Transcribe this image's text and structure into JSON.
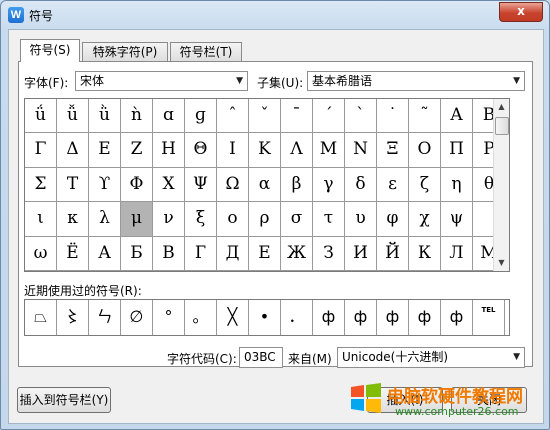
{
  "window": {
    "title": "符号",
    "close_label": "x",
    "app_icon": "W"
  },
  "tabs": [
    {
      "label": "符号(S)",
      "active": true
    },
    {
      "label": "特殊字符(P)",
      "active": false
    },
    {
      "label": "符号栏(T)",
      "active": false
    }
  ],
  "font": {
    "label": "字体(F):",
    "value": "宋体"
  },
  "subset": {
    "label": "子集(U):",
    "value": "基本希腊语"
  },
  "symbols": [
    [
      "ǘ",
      "ǚ",
      "ǜ",
      "ǹ",
      "ɑ",
      "ɡ",
      "ˆ",
      "ˇ",
      "ˉ",
      "ˊ",
      "ˋ",
      "˙",
      "˜",
      "Α",
      "Β"
    ],
    [
      "Γ",
      "Δ",
      "Ε",
      "Ζ",
      "Η",
      "Θ",
      "Ι",
      "Κ",
      "Λ",
      "Μ",
      "Ν",
      "Ξ",
      "Ο",
      "Π",
      "Ρ"
    ],
    [
      "Σ",
      "Τ",
      "ϒ",
      "Φ",
      "Χ",
      "Ψ",
      "Ω",
      "α",
      "β",
      "γ",
      "δ",
      "ε",
      "ζ",
      "η",
      "θ"
    ],
    [
      "ι",
      "κ",
      "λ",
      "μ",
      "ν",
      "ξ",
      "ο",
      "ρ",
      "σ",
      "τ",
      "υ",
      "φ",
      "χ",
      "ψ",
      ""
    ],
    [
      "ω",
      "Ё",
      "А",
      "Б",
      "В",
      "Г",
      "Д",
      "Е",
      "Ж",
      "З",
      "И",
      "Й",
      "К",
      "Л",
      "М"
    ]
  ],
  "selected_symbol": "μ",
  "recent": {
    "label": "近期使用过的符号(R):",
    "items": [
      "⏢",
      "〻",
      "ㄣ",
      "∅",
      "°",
      "。",
      "╳",
      "•",
      "．",
      "ф",
      "ф",
      "ф",
      "ф",
      "ф",
      "TEL"
    ]
  },
  "char_code": {
    "label": "字符代码(C):",
    "value": "03BC"
  },
  "from": {
    "label": "来自(M)",
    "value": "Unicode(十六进制)"
  },
  "buttons": {
    "insert_to_bar": "插入到符号栏(Y)",
    "insert": "插入(I)",
    "close": "关闭"
  },
  "watermark": {
    "title": "电脑软硬件教程网",
    "url": "www.computer26.com"
  },
  "colors": {
    "title_bar": "#dbe8f5",
    "selected_cell": "#b3b3b3",
    "close_button": "#c9442e",
    "watermark_text": "#f07a00"
  }
}
